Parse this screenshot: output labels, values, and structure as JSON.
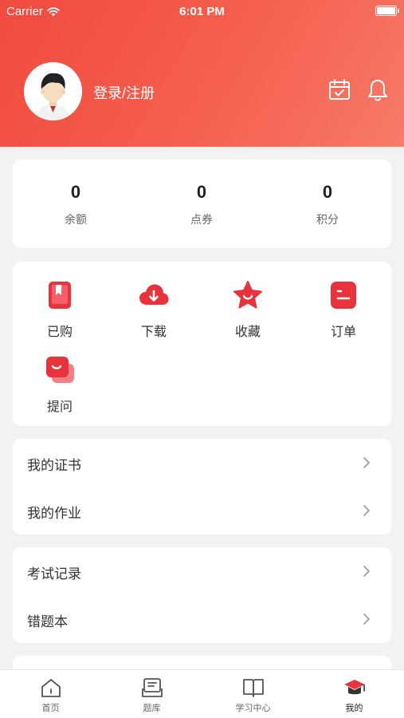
{
  "status_bar": {
    "carrier": "Carrier",
    "time": "6:01 PM"
  },
  "header": {
    "login_label": "登录/注册"
  },
  "stats": [
    {
      "value": "0",
      "label": "余额"
    },
    {
      "value": "0",
      "label": "点券"
    },
    {
      "value": "0",
      "label": "积分"
    }
  ],
  "features": [
    {
      "label": "已购",
      "icon": "book-icon"
    },
    {
      "label": "下载",
      "icon": "cloud-download-icon"
    },
    {
      "label": "收藏",
      "icon": "star-icon"
    },
    {
      "label": "订单",
      "icon": "order-icon"
    },
    {
      "label": "提问",
      "icon": "question-chat-icon"
    }
  ],
  "menu_group_1": [
    {
      "label": "我的证书"
    },
    {
      "label": "我的作业"
    }
  ],
  "menu_group_2": [
    {
      "label": "考试记录"
    },
    {
      "label": "错题本"
    }
  ],
  "tabs": [
    {
      "label": "首页",
      "icon": "home-icon"
    },
    {
      "label": "题库",
      "icon": "question-bank-icon"
    },
    {
      "label": "学习中心",
      "icon": "open-book-icon"
    },
    {
      "label": "我的",
      "icon": "graduation-cap-icon",
      "active": true
    }
  ],
  "colors": {
    "accent": "#e8323c",
    "header_start": "#f04a3e",
    "header_end": "#f77a68"
  }
}
